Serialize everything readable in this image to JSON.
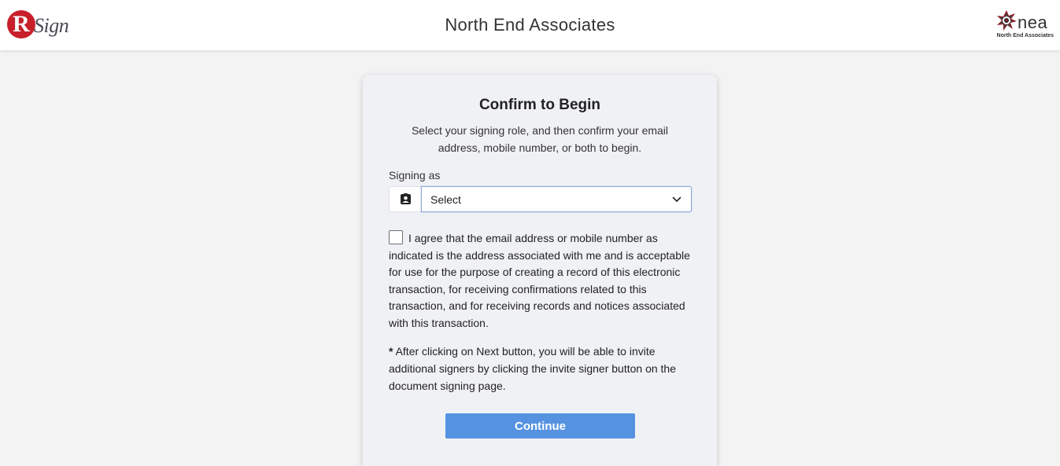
{
  "header": {
    "title": "North End Associates",
    "left_logo_letter": "R",
    "left_logo_word": "Sign",
    "right_logo_word": "nea",
    "right_logo_sub": "North End Associates"
  },
  "card": {
    "title": "Confirm to Begin",
    "subtitle": "Select your signing role, and then confirm your email address, mobile number, or both to begin.",
    "signing_label": "Signing as",
    "role_icon": "contact-card-icon",
    "select_value": "Select",
    "agree_text": "I agree that the email address or mobile number as indicated is the address associated with me and is acceptable for use for the purpose of creating a record of this electronic transaction, for receiving confirmations related to this transaction, and for receiving records and notices associated with this transaction.",
    "note_star": "*",
    "note_text": " After clicking on Next button, you will be able to invite additional signers by clicking the invite signer button on the document signing page.",
    "continue_label": "Continue"
  },
  "colors": {
    "brand_red": "#c8202b",
    "button_blue": "#5593e1",
    "select_border": "#8ea9d6",
    "card_bg": "#f0f1f5",
    "page_bg": "#f3f3f4"
  }
}
